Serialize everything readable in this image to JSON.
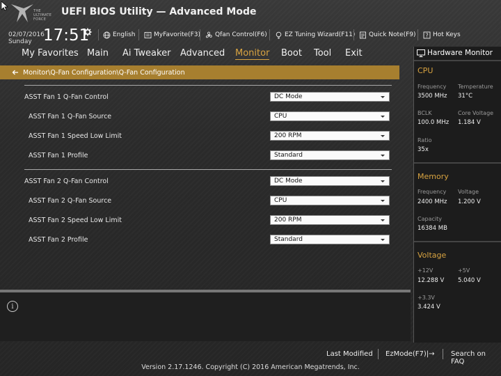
{
  "header": {
    "app_title": "UEFI BIOS Utility — Advanced Mode",
    "logo_text": "THE ULTIMATE FORCE",
    "date": "02/07/2016",
    "day": "Sunday",
    "time": "17:51",
    "language": "English",
    "my_favorite": "MyFavorite(F3)",
    "qfan_control": "Qfan Control(F6)",
    "ez_tuning": "EZ Tuning Wizard(F11)",
    "quick_note": "Quick Note(F9)",
    "hot_keys": "Hot Keys"
  },
  "menu": {
    "items": [
      "My Favorites",
      "Main",
      "Ai Tweaker",
      "Advanced",
      "Monitor",
      "Boot",
      "Tool",
      "Exit"
    ],
    "active": "Monitor"
  },
  "breadcrumb": "Monitor\\Q-Fan Configuration\\Q-Fan Configuration",
  "settings": [
    {
      "label": "ASST Fan 1 Q-Fan Control",
      "value": "DC Mode"
    },
    {
      "label": "ASST Fan 1 Q-Fan Source",
      "value": "CPU"
    },
    {
      "label": "ASST Fan 1 Speed Low Limit",
      "value": "200 RPM"
    },
    {
      "label": "ASST Fan 1 Profile",
      "value": "Standard"
    },
    {
      "label": "ASST Fan 2 Q-Fan Control",
      "value": "DC Mode"
    },
    {
      "label": "ASST Fan 2 Q-Fan Source",
      "value": "CPU"
    },
    {
      "label": "ASST Fan 2 Speed Low Limit",
      "value": "200 RPM"
    },
    {
      "label": "ASST Fan 2 Profile",
      "value": "Standard"
    }
  ],
  "hardware_monitor": {
    "title": "Hardware Monitor",
    "cpu": {
      "heading": "CPU",
      "frequency_label": "Frequency",
      "frequency": "3500 MHz",
      "temperature_label": "Temperature",
      "temperature": "31°C",
      "bclk_label": "BCLK",
      "bclk": "100.0 MHz",
      "core_voltage_label": "Core Voltage",
      "core_voltage": "1.184 V",
      "ratio_label": "Ratio",
      "ratio": "35x"
    },
    "memory": {
      "heading": "Memory",
      "frequency_label": "Frequency",
      "frequency": "2400 MHz",
      "voltage_label": "Voltage",
      "voltage": "1.200 V",
      "capacity_label": "Capacity",
      "capacity": "16384 MB"
    },
    "voltage": {
      "heading": "Voltage",
      "v12_label": "+12V",
      "v12": "12.288 V",
      "v5_label": "+5V",
      "v5": "5.040 V",
      "v33_label": "+3.3V",
      "v33": "3.424 V"
    }
  },
  "footer": {
    "last_modified": "Last Modified",
    "ez_mode": "EzMode(F7)|→",
    "search_faq": "Search on FAQ",
    "copyright": "Version 2.17.1246. Copyright (C) 2016 American Megatrends, Inc."
  },
  "colors": {
    "accent": "#d9a441",
    "breadcrumb_bg": "#a77f2f"
  }
}
